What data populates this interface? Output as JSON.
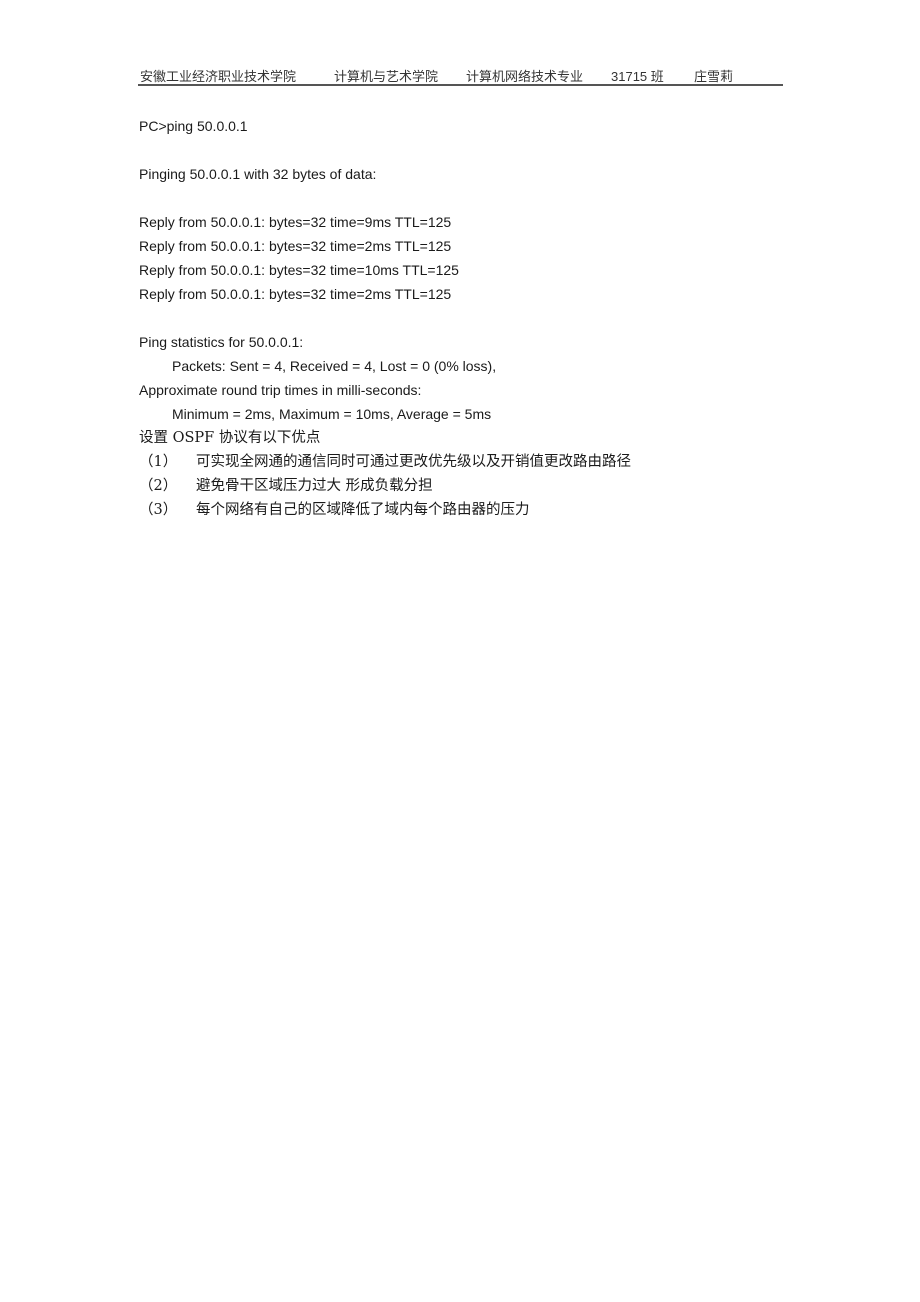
{
  "header": {
    "school": "安徽工业经济职业技术学院",
    "college": "计算机与艺术学院",
    "major": "计算机网络技术专业",
    "class": "31715 班",
    "name": "庄雪莉"
  },
  "ping": {
    "command": "PC>ping 50.0.0.1",
    "pinging": "Pinging 50.0.0.1 with 32 bytes of data:",
    "replies": [
      "Reply from 50.0.0.1: bytes=32 time=9ms TTL=125",
      "Reply from 50.0.0.1: bytes=32 time=2ms TTL=125",
      "Reply from 50.0.0.1: bytes=32 time=10ms TTL=125",
      "Reply from 50.0.0.1: bytes=32 time=2ms TTL=125"
    ],
    "stats_title": "Ping statistics for 50.0.0.1:",
    "packets": "Packets: Sent = 4, Received = 4, Lost = 0 (0% loss),",
    "rtt_title": "Approximate round trip times in milli-seconds:",
    "rtt_values": "Minimum = 2ms, Maximum = 10ms, Average = 5ms"
  },
  "ospf": {
    "heading": "设置 OSPF 协议有以下优点",
    "items": [
      {
        "num": "（1）",
        "text": "可实现全网通的通信同时可通过更改优先级以及开销值更改路由路径"
      },
      {
        "num": "（2）",
        "text": "避免骨干区域压力过大  形成负载分担"
      },
      {
        "num": "（3）",
        "text": "每个网络有自己的区域降低了域内每个路由器的压力"
      }
    ]
  }
}
